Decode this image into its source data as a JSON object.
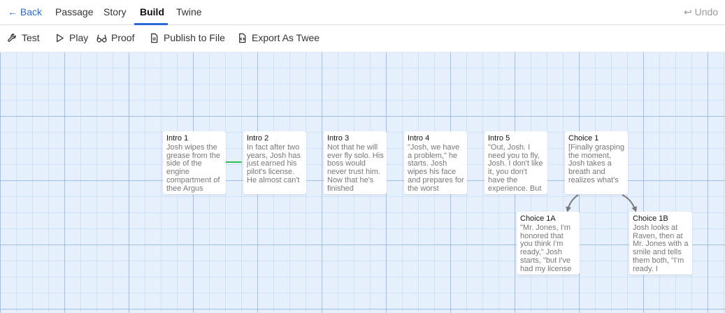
{
  "topbar": {
    "back": "← Back",
    "tabs": [
      "Passage",
      "Story",
      "Build",
      "Twine"
    ],
    "active_tab": "Build",
    "undo": "↩ Undo"
  },
  "toolbar": {
    "test": "Test",
    "play": "Play",
    "proof": "Proof",
    "publish": "Publish to File",
    "export": "Export As Twee"
  },
  "passages": [
    {
      "title": "Intro 1",
      "excerpt": "Josh wipes the grease from the side of the engine compartment of thee Argus"
    },
    {
      "title": "Intro 2",
      "excerpt": "In fact after two years, Josh has just earned his pilot's license. He almost can't"
    },
    {
      "title": "Intro 3",
      "excerpt": "Not that he will ever fly solo. His boss would never trust him. Now that he's finished"
    },
    {
      "title": "Intro 4",
      "excerpt": "\"Josh, we have a problem,\" he starts. Josh wipes his face and prepares for the worst"
    },
    {
      "title": "Intro 5",
      "excerpt": "\"Out, Josh. I need you to fly, Josh. I don't like it, you don't have the experience. But"
    },
    {
      "title": "Choice 1",
      "excerpt": "[Finally grasping the moment, Josh takes a breath and realizes what's"
    },
    {
      "title": "Choice 1A",
      "excerpt": "\"Mr. Jones, I'm honored that you think I'm ready,\" Josh starts, \"but I've had my license"
    },
    {
      "title": "Choice 1B",
      "excerpt": "Josh looks at Raven, then at Mr. Jones with a smile and tells them both, \"I'm ready. I"
    }
  ],
  "colors": {
    "accent": "#2a6ad8",
    "canvas": "#e6f0fd",
    "link_highlight": "#2fbf4a",
    "link_arrow": "#7a7a7a"
  },
  "icons": {
    "test": "wrench-icon",
    "play": "play-icon",
    "proof": "glasses-icon",
    "publish": "file-icon",
    "export": "file-code-icon",
    "undo": "undo-icon"
  }
}
